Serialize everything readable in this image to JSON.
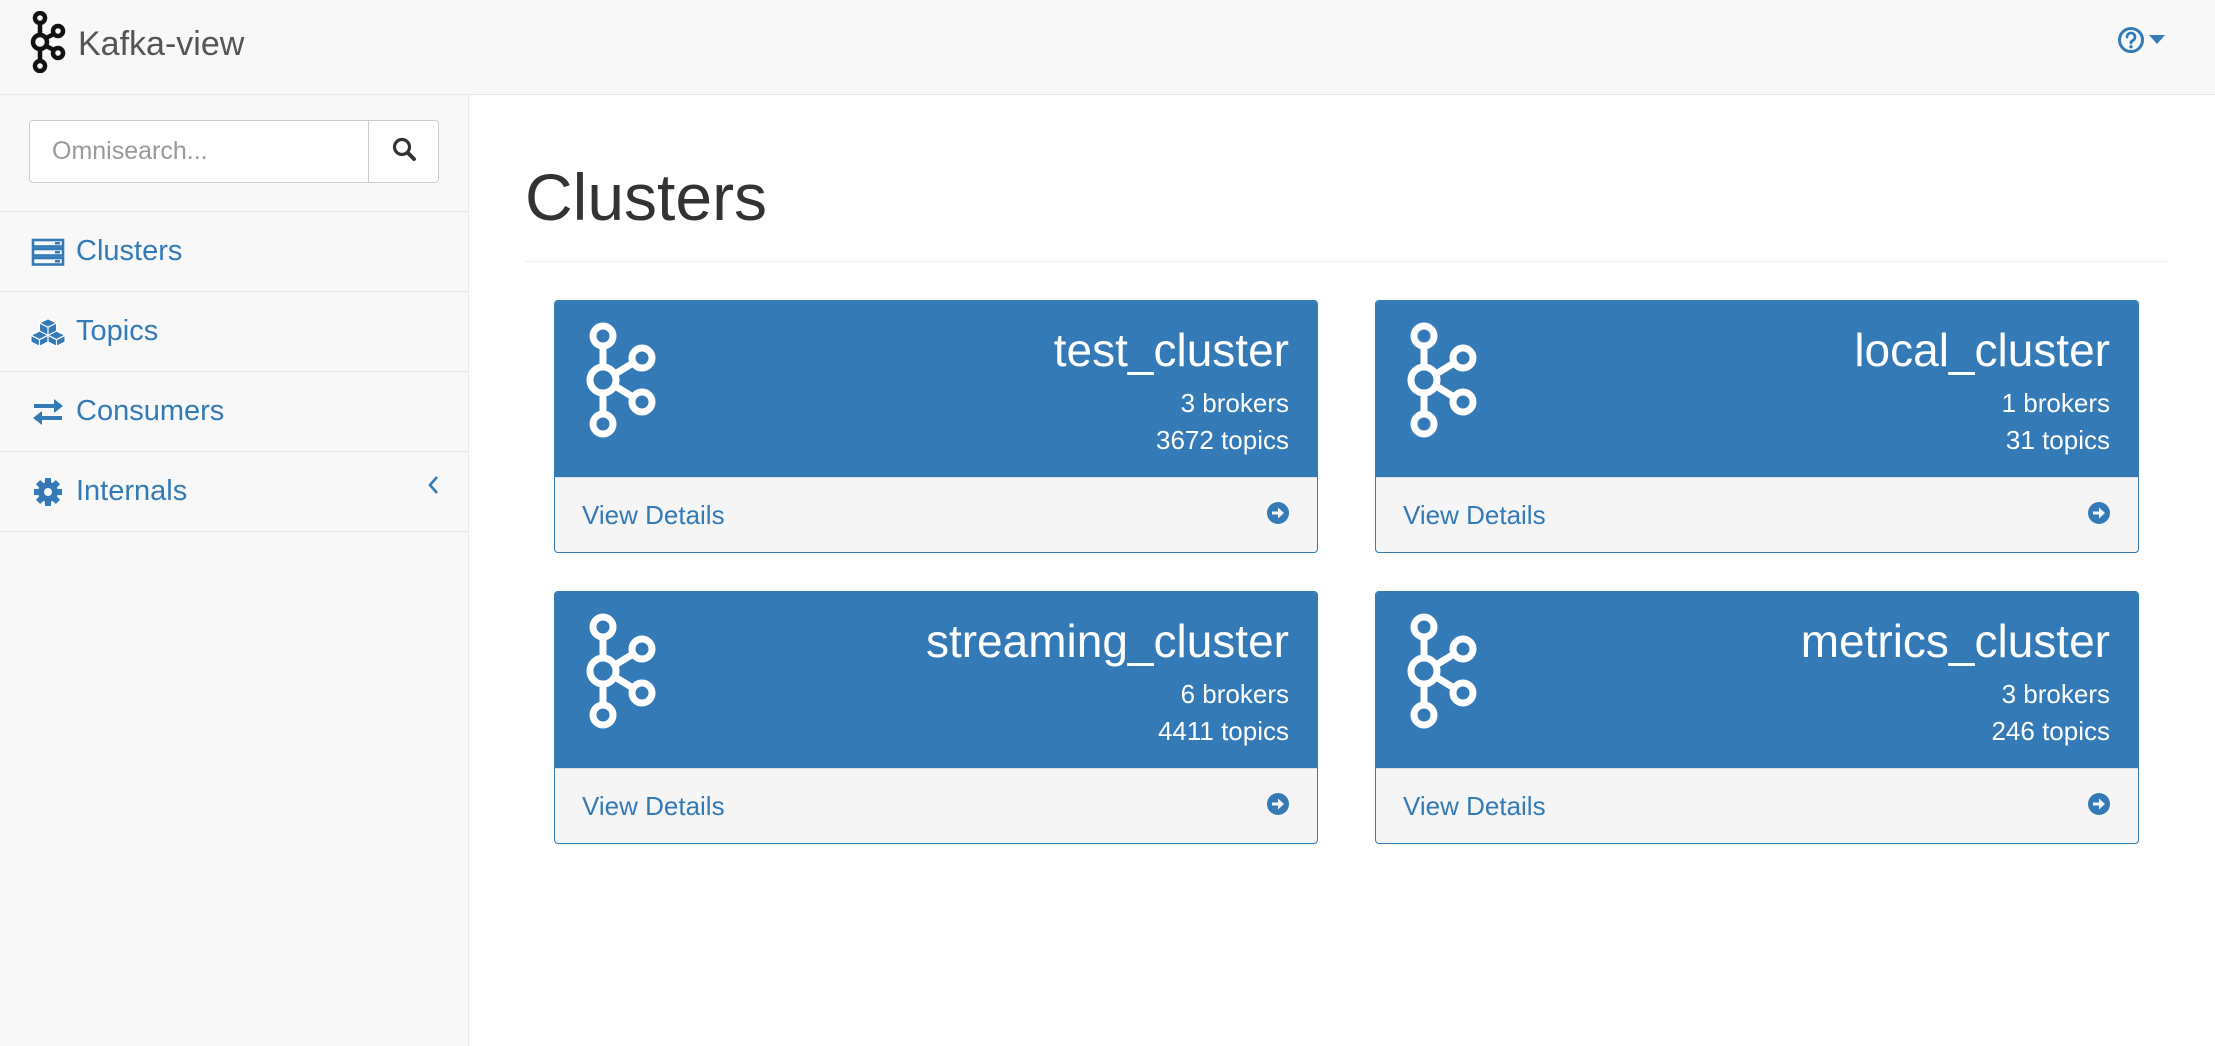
{
  "app": {
    "title": "Kafka-view"
  },
  "header": {
    "help_icon": "question-circle-icon",
    "caret_icon": "caret-down-icon"
  },
  "search": {
    "placeholder": "Omnisearch...",
    "value": ""
  },
  "sidebar": {
    "items": [
      {
        "label": "Clusters",
        "icon": "server-icon"
      },
      {
        "label": "Topics",
        "icon": "cubes-icon"
      },
      {
        "label": "Consumers",
        "icon": "exchange-icon"
      },
      {
        "label": "Internals",
        "icon": "gear-icon"
      }
    ]
  },
  "main": {
    "title": "Clusters"
  },
  "clusters": [
    {
      "name": "test_cluster",
      "brokers": "3 brokers",
      "topics": "3672 topics",
      "link": "View Details"
    },
    {
      "name": "local_cluster",
      "brokers": "1 brokers",
      "topics": "31 topics",
      "link": "View Details"
    },
    {
      "name": "streaming_cluster",
      "brokers": "6 brokers",
      "topics": "4411 topics",
      "link": "View Details"
    },
    {
      "name": "metrics_cluster",
      "brokers": "3 brokers",
      "topics": "246 topics",
      "link": "View Details"
    }
  ],
  "colors": {
    "primary": "#337ab7",
    "navbar_bg": "#f8f8f8",
    "panel_footer_bg": "#f5f5f5"
  }
}
